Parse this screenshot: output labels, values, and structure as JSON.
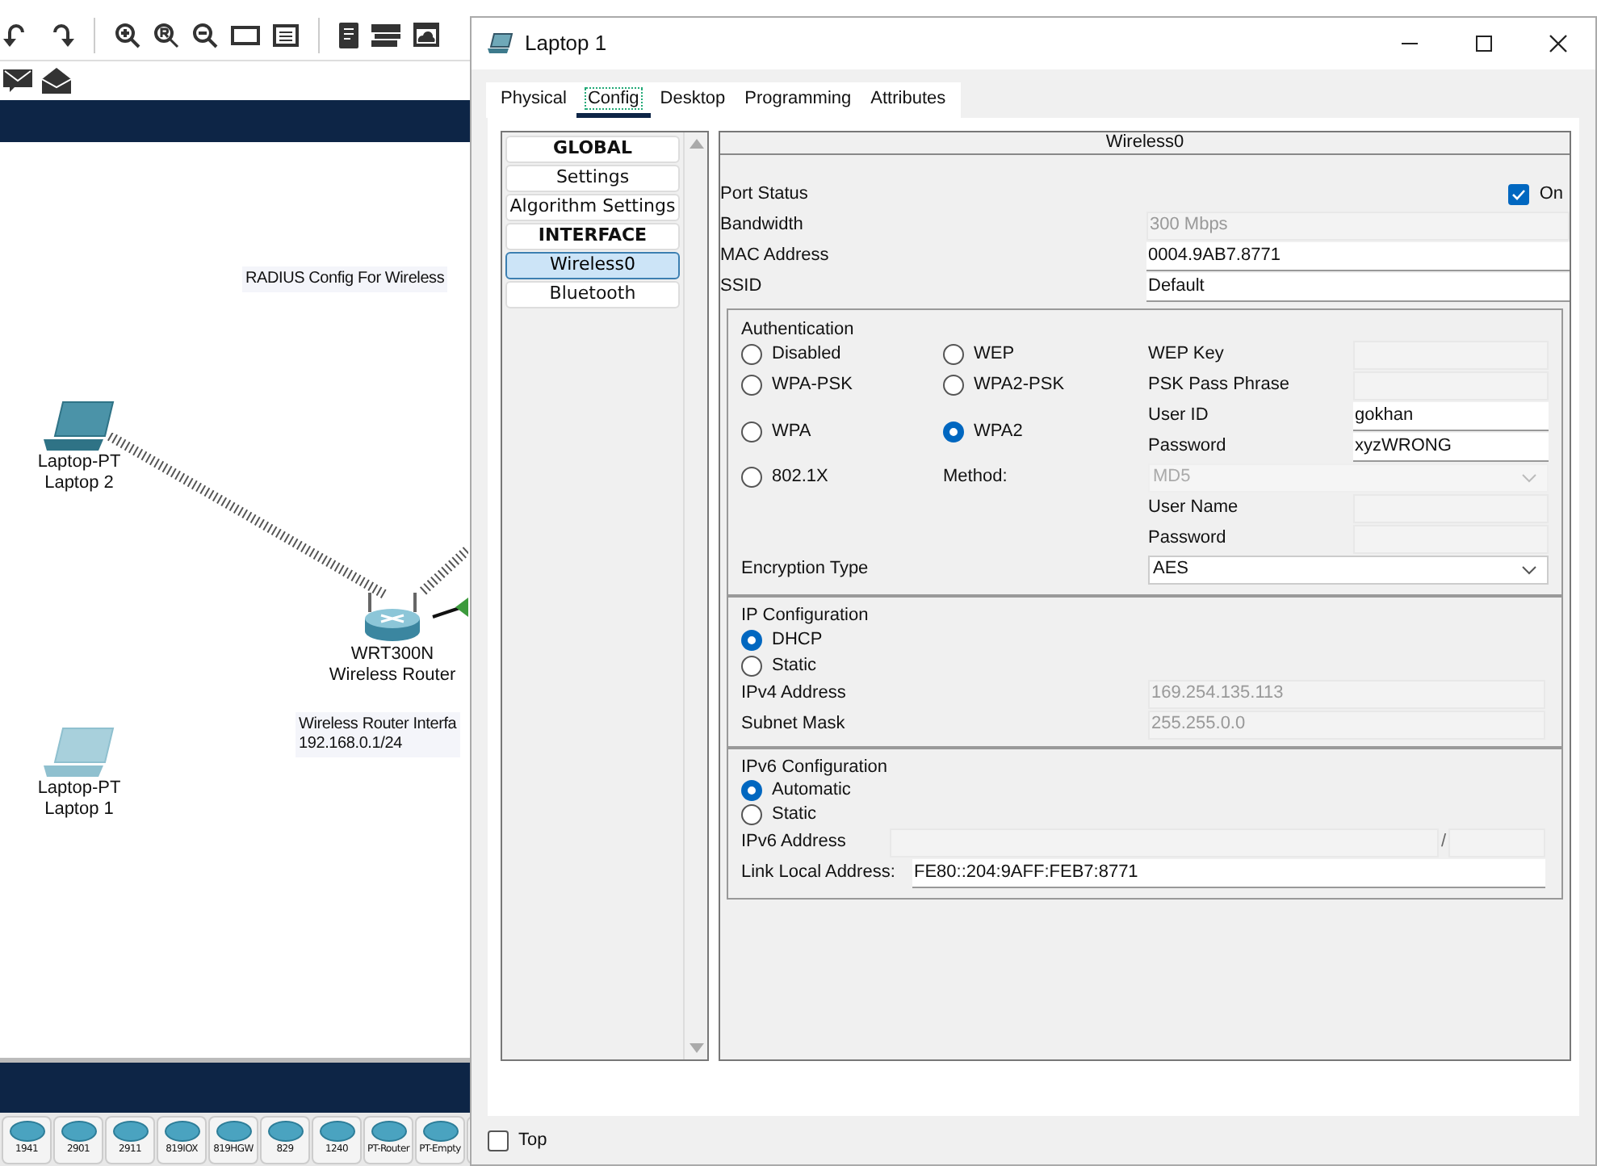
{
  "app": {
    "device_strip": [
      "1941",
      "2901",
      "2911",
      "819IOX",
      "819HGW",
      "829",
      "1240",
      "PT-Router",
      "PT-Empty"
    ]
  },
  "canvas": {
    "notes": [
      {
        "lines": [
          "RADIUS Config For Wireless"
        ]
      },
      {
        "lines": [
          "Wireless Router Interfa",
          "192.168.0.1/24"
        ]
      }
    ],
    "devices": [
      {
        "kind": "laptop",
        "lines": [
          "Laptop-PT",
          "Laptop 2"
        ],
        "faded": false
      },
      {
        "kind": "router",
        "lines": [
          "WRT300N",
          "Wireless Router"
        ]
      },
      {
        "kind": "laptop",
        "lines": [
          "Laptop-PT",
          "Laptop 1"
        ],
        "faded": true
      }
    ]
  },
  "dialog": {
    "title": "Laptop 1",
    "tabs": [
      {
        "label": "Physical",
        "selected": false
      },
      {
        "label": "Config",
        "selected": true
      },
      {
        "label": "Desktop",
        "selected": false
      },
      {
        "label": "Programming",
        "selected": false
      },
      {
        "label": "Attributes",
        "selected": false
      }
    ],
    "sidebar": [
      {
        "label": "GLOBAL",
        "kind": "header"
      },
      {
        "label": "Settings",
        "kind": "item",
        "selected": false
      },
      {
        "label": "Algorithm Settings",
        "kind": "item",
        "selected": false
      },
      {
        "label": "INTERFACE",
        "kind": "header"
      },
      {
        "label": "Wireless0",
        "kind": "item",
        "selected": true
      },
      {
        "label": "Bluetooth",
        "kind": "item",
        "selected": false
      }
    ],
    "panel": {
      "header": "Wireless0",
      "port_status": {
        "label": "Port Status",
        "checked": true,
        "checkbox_label": "On"
      },
      "fields": [
        {
          "label": "Bandwidth",
          "value": "300 Mbps",
          "disabled": true
        },
        {
          "label": "MAC Address",
          "value": "0004.9AB7.8771",
          "disabled": false
        },
        {
          "label": "SSID",
          "value": "Default",
          "disabled": false
        }
      ],
      "authentication": {
        "title": "Authentication",
        "radios": [
          {
            "label": "Disabled",
            "selected": false
          },
          {
            "label": "WEP",
            "selected": false
          },
          {
            "label": "WPA-PSK",
            "selected": false
          },
          {
            "label": "WPA2-PSK",
            "selected": false
          },
          {
            "label": "WPA",
            "selected": false
          },
          {
            "label": "WPA2",
            "selected": true
          },
          {
            "label": "802.1X",
            "selected": false
          }
        ],
        "fields": [
          {
            "label": "WEP Key",
            "disabled": true
          },
          {
            "label": "PSK Pass Phrase",
            "disabled": true
          },
          {
            "label": "User ID",
            "value": "gokhan",
            "disabled": false
          },
          {
            "label": "Password",
            "value": "xyzWRONG",
            "disabled": false
          }
        ],
        "method": {
          "label": "Method:",
          "value": "MD5",
          "disabled": true
        },
        "method_fields": [
          {
            "label": "User Name",
            "disabled": true
          },
          {
            "label": "Password",
            "disabled": true
          }
        ],
        "encryption": {
          "label": "Encryption Type",
          "value": "AES",
          "disabled": false
        }
      },
      "ip_config": {
        "title": "IP Configuration",
        "radios": [
          {
            "label": "DHCP",
            "selected": true
          },
          {
            "label": "Static",
            "selected": false
          }
        ],
        "fields": [
          {
            "label": "IPv4 Address",
            "value": "169.254.135.113",
            "disabled": true
          },
          {
            "label": "Subnet Mask",
            "value": "255.255.0.0",
            "disabled": true
          }
        ]
      },
      "ipv6_config": {
        "title": "IPv6 Configuration",
        "radios": [
          {
            "label": "Automatic",
            "selected": true
          },
          {
            "label": "Static",
            "selected": false
          }
        ],
        "address": {
          "label": "IPv6 Address",
          "separator": "/",
          "disabled": true
        },
        "link_local": {
          "label": "Link Local Address:",
          "value": "FE80::204:9AFF:FEB7:8771",
          "disabled": false
        }
      }
    },
    "top_checkbox": {
      "label": "Top",
      "checked": false
    }
  }
}
